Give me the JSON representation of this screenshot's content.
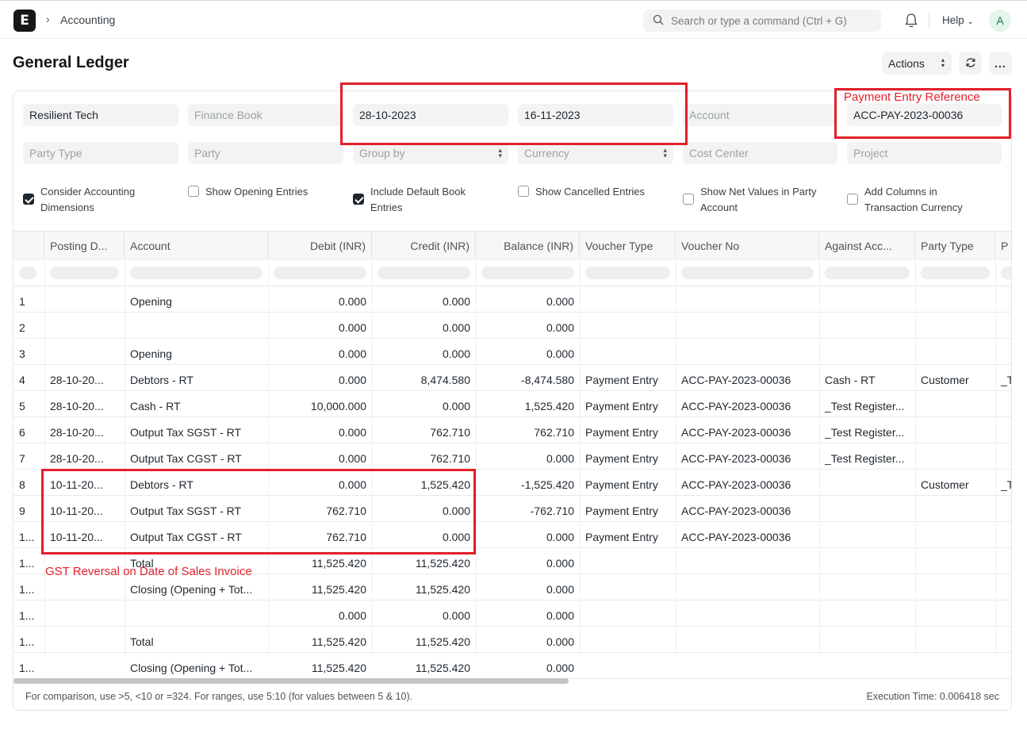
{
  "navbar": {
    "logo": "E",
    "breadcrumb": "Accounting",
    "search_placeholder": "Search or type a command (Ctrl + G)",
    "help": "Help",
    "avatar": "A"
  },
  "page": {
    "title": "General Ledger",
    "actions_label": "Actions",
    "more_label": "..."
  },
  "filters": {
    "company": "Resilient Tech",
    "finance_book": "Finance Book",
    "from_date": "28-10-2023",
    "to_date": "16-11-2023",
    "account": "Account",
    "voucher_no": "ACC-PAY-2023-00036",
    "party_type": "Party Type",
    "party": "Party",
    "group_by": "Group by",
    "currency": "Currency",
    "cost_center": "Cost Center",
    "project": "Project"
  },
  "checkboxes": [
    {
      "label": "Consider Accounting Dimensions",
      "checked": true
    },
    {
      "label": "Show Opening Entries",
      "checked": false
    },
    {
      "label": "Include Default Book Entries",
      "checked": true
    },
    {
      "label": "Show Cancelled Entries",
      "checked": false
    },
    {
      "label": "Show Net Values in Party Account",
      "checked": false
    },
    {
      "label": "Add Columns in Transaction Currency",
      "checked": false
    }
  ],
  "table": {
    "columns": [
      "",
      "Posting D...",
      "Account",
      "Debit (INR)",
      "Credit (INR)",
      "Balance (INR)",
      "Voucher Type",
      "Voucher No",
      "Against Acc...",
      "Party Type",
      "P"
    ],
    "rows": [
      [
        "1",
        "",
        "Opening",
        "0.000",
        "0.000",
        "0.000",
        "",
        "",
        "",
        "",
        ""
      ],
      [
        "2",
        "",
        "",
        "0.000",
        "0.000",
        "0.000",
        "",
        "",
        "",
        "",
        ""
      ],
      [
        "3",
        "",
        "Opening",
        "0.000",
        "0.000",
        "0.000",
        "",
        "",
        "",
        "",
        ""
      ],
      [
        "4",
        "28-10-20...",
        "Debtors - RT",
        "0.000",
        "8,474.580",
        "-8,474.580",
        "Payment Entry",
        "ACC-PAY-2023-00036",
        "Cash - RT",
        "Customer",
        "_T"
      ],
      [
        "5",
        "28-10-20...",
        "Cash - RT",
        "10,000.000",
        "0.000",
        "1,525.420",
        "Payment Entry",
        "ACC-PAY-2023-00036",
        "_Test Register...",
        "",
        ""
      ],
      [
        "6",
        "28-10-20...",
        "Output Tax SGST - RT",
        "0.000",
        "762.710",
        "762.710",
        "Payment Entry",
        "ACC-PAY-2023-00036",
        "_Test Register...",
        "",
        ""
      ],
      [
        "7",
        "28-10-20...",
        "Output Tax CGST - RT",
        "0.000",
        "762.710",
        "0.000",
        "Payment Entry",
        "ACC-PAY-2023-00036",
        "_Test Register...",
        "",
        ""
      ],
      [
        "8",
        "10-11-20...",
        "Debtors - RT",
        "0.000",
        "1,525.420",
        "-1,525.420",
        "Payment Entry",
        "ACC-PAY-2023-00036",
        "",
        "Customer",
        "_T"
      ],
      [
        "9",
        "10-11-20...",
        "Output Tax SGST - RT",
        "762.710",
        "0.000",
        "-762.710",
        "Payment Entry",
        "ACC-PAY-2023-00036",
        "",
        "",
        ""
      ],
      [
        "1...",
        "10-11-20...",
        "Output Tax CGST - RT",
        "762.710",
        "0.000",
        "0.000",
        "Payment Entry",
        "ACC-PAY-2023-00036",
        "",
        "",
        ""
      ],
      [
        "1...",
        "",
        "Total",
        "11,525.420",
        "11,525.420",
        "0.000",
        "",
        "",
        "",
        "",
        ""
      ],
      [
        "1...",
        "",
        "Closing (Opening + Tot...",
        "11,525.420",
        "11,525.420",
        "0.000",
        "",
        "",
        "",
        "",
        ""
      ],
      [
        "1...",
        "",
        "",
        "0.000",
        "0.000",
        "0.000",
        "",
        "",
        "",
        "",
        ""
      ],
      [
        "1...",
        "",
        "Total",
        "11,525.420",
        "11,525.420",
        "0.000",
        "",
        "",
        "",
        "",
        ""
      ],
      [
        "1...",
        "",
        "Closing (Opening + Tot...",
        "11,525.420",
        "11,525.420",
        "0.000",
        "",
        "",
        "",
        "",
        ""
      ]
    ]
  },
  "footer": {
    "hint": "For comparison, use >5, <10 or =324. For ranges, use 5:10 (for values between 5 & 10).",
    "execution_time": "Execution Time: 0.006418 sec"
  },
  "annotations": {
    "payment_ref": "Payment Entry Reference",
    "gst_reversal": "GST Reversal on Date of Sales Invoice",
    "color": "#e3202a"
  }
}
